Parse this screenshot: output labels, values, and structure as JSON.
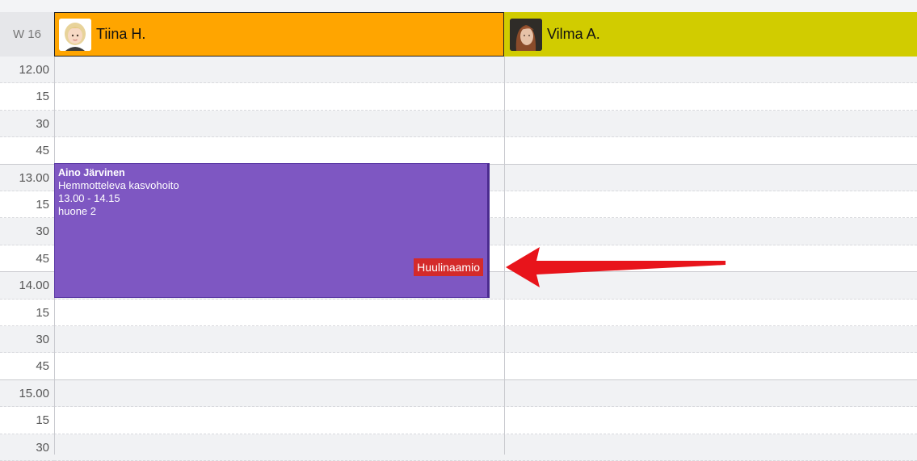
{
  "calendar": {
    "week_label": "W 16",
    "staff": [
      {
        "name": "Tiina H.",
        "color": "#ffa500",
        "avatar": "illustrated-woman-avatar"
      },
      {
        "name": "Vilma A.",
        "color": "#d1cc00",
        "avatar": "photo-woman-avatar"
      }
    ],
    "time_slots": [
      "12.00",
      "15",
      "30",
      "45",
      "13.00",
      "15",
      "30",
      "45",
      "14.00",
      "15",
      "30",
      "45",
      "15.00",
      "15",
      "30"
    ]
  },
  "appointment": {
    "client": "Aino Järvinen",
    "service": "Hemmotteleva kasvohoito",
    "time": "13.00 - 14.15",
    "room": "huone 2",
    "tag": "Huulinaamio",
    "color": "#7e57c2",
    "tag_color": "#d42a2a"
  },
  "annotation": {
    "arrow_color": "#e8141b",
    "icon": "red-arrow-icon"
  }
}
